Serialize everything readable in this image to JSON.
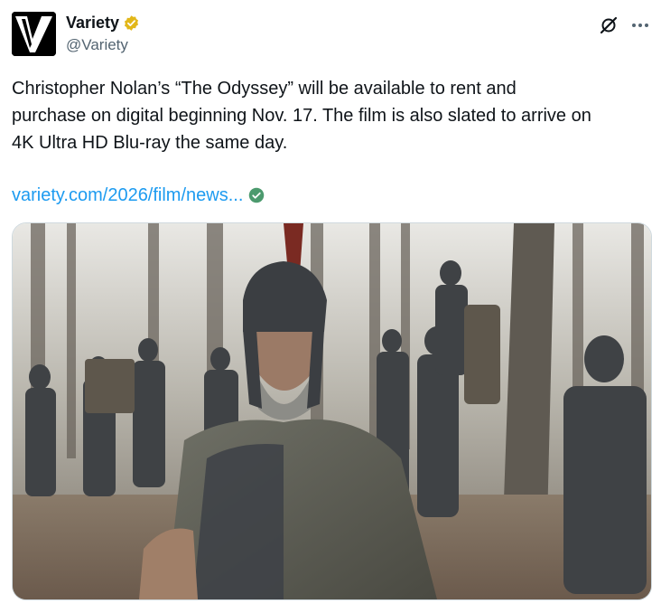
{
  "author": {
    "display_name": "Variety",
    "handle": "@Variety",
    "avatar_letter": "V",
    "verified_icon": "gold-verified-badge-icon",
    "verified_color": "#e2b719"
  },
  "actions": {
    "grok_icon": "grok-icon",
    "more_icon": "more-options-icon"
  },
  "tweet": {
    "text": "Christopher Nolan’s “The Odyssey” will be available to rent and\npurchase on digital beginning Nov. 17. The film is also slated to arrive on\n4K Ultra HD Blu-ray the same day.",
    "link_text": "variety.com/2026/film/news...",
    "link_badge_icon": "verified-link-check-icon",
    "link_color": "#1d9bf0"
  },
  "media": {
    "image_icon": "movie-still-image"
  }
}
